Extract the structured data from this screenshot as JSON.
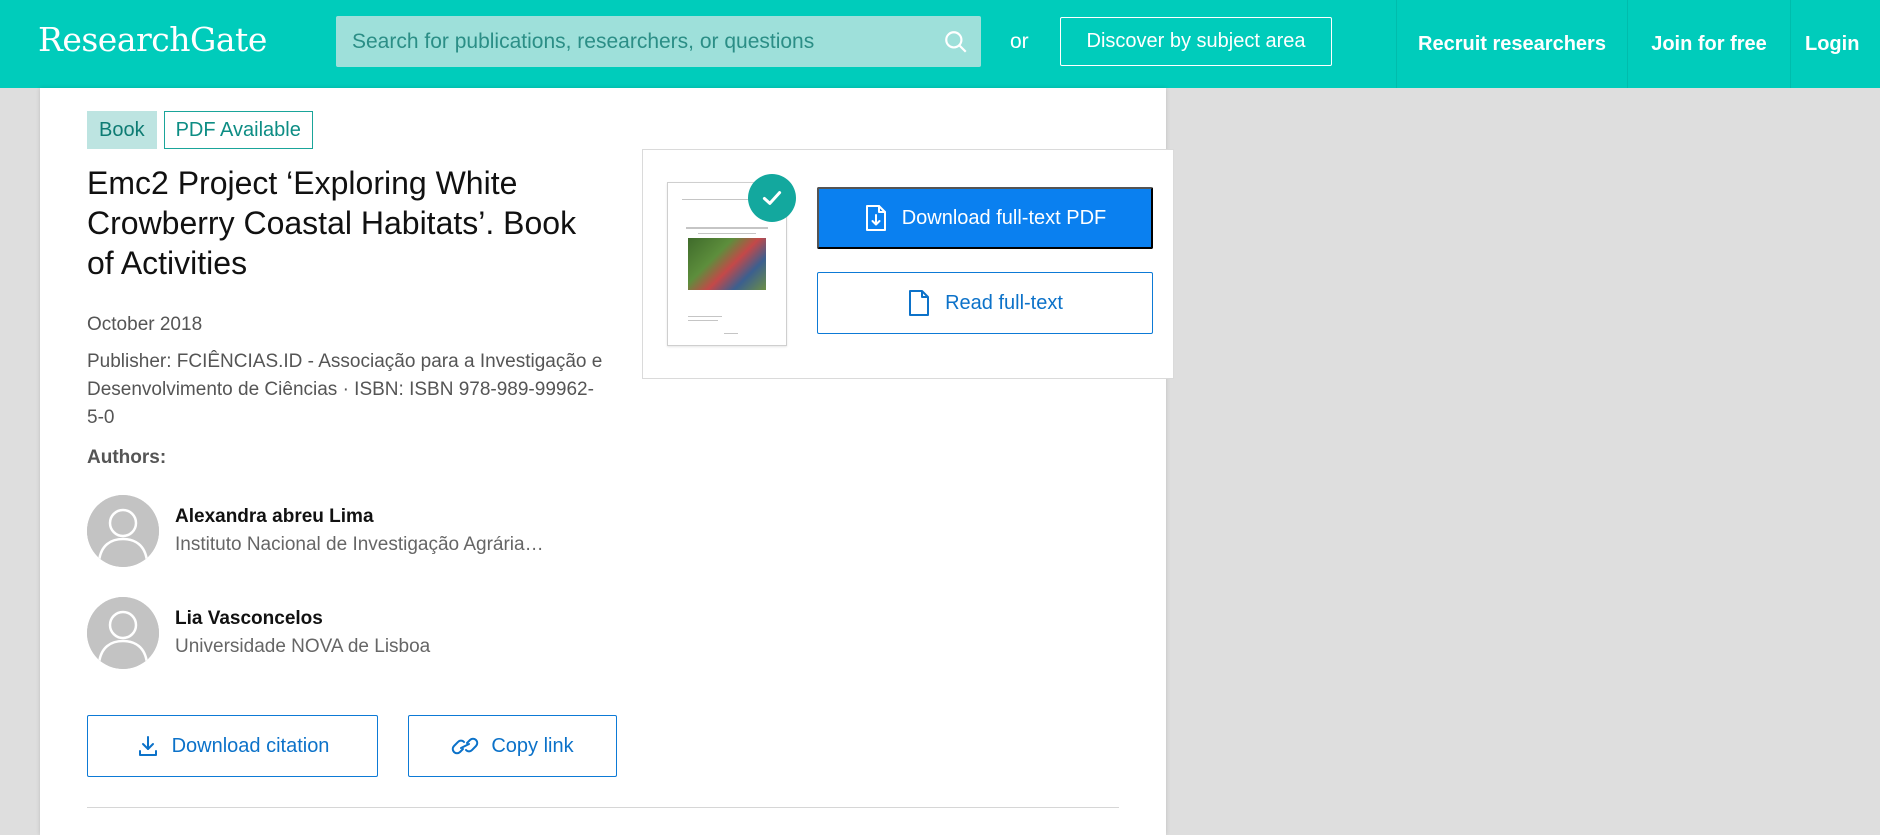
{
  "header": {
    "logo": "ResearchGate",
    "search_placeholder": "Search for publications, researchers, or questions",
    "or_text": "or",
    "discover_label": "Discover by subject area",
    "nav": {
      "recruit": "Recruit researchers",
      "join": "Join for free",
      "login": "Login"
    }
  },
  "publication": {
    "badges": {
      "type": "Book",
      "pdf": "PDF Available"
    },
    "title": "Emc2 Project ‘Exploring White Crowberry Coastal Habitats’. Book of Activities",
    "date": "October 2018",
    "publisher": "Publisher: FCIÊNCIAS.ID - Associação para a Investigação e Desenvolvimento de Ciências · ISBN: ISBN 978-989-99962-5-0",
    "authors_label": "Authors:",
    "authors": [
      {
        "name": "Alexandra abreu Lima",
        "institution": "Instituto Nacional de Investigação Agrária…"
      },
      {
        "name": "Lia Vasconcelos",
        "institution": "Universidade NOVA de Lisboa"
      }
    ]
  },
  "actions": {
    "download_citation": "Download citation",
    "copy_link": "Copy link",
    "download_pdf": "Download full-text PDF",
    "read_fulltext": "Read full-text"
  },
  "colors": {
    "brand": "#00ccbb",
    "primary_button": "#0a80f0",
    "link": "#0c72c9",
    "check_badge": "#13a89e"
  },
  "icons": {
    "search": "search-icon",
    "download": "download-icon",
    "link": "link-icon",
    "pdf_file": "pdf-file-icon",
    "document": "document-icon",
    "check": "check-icon",
    "avatar": "avatar-placeholder-icon"
  }
}
